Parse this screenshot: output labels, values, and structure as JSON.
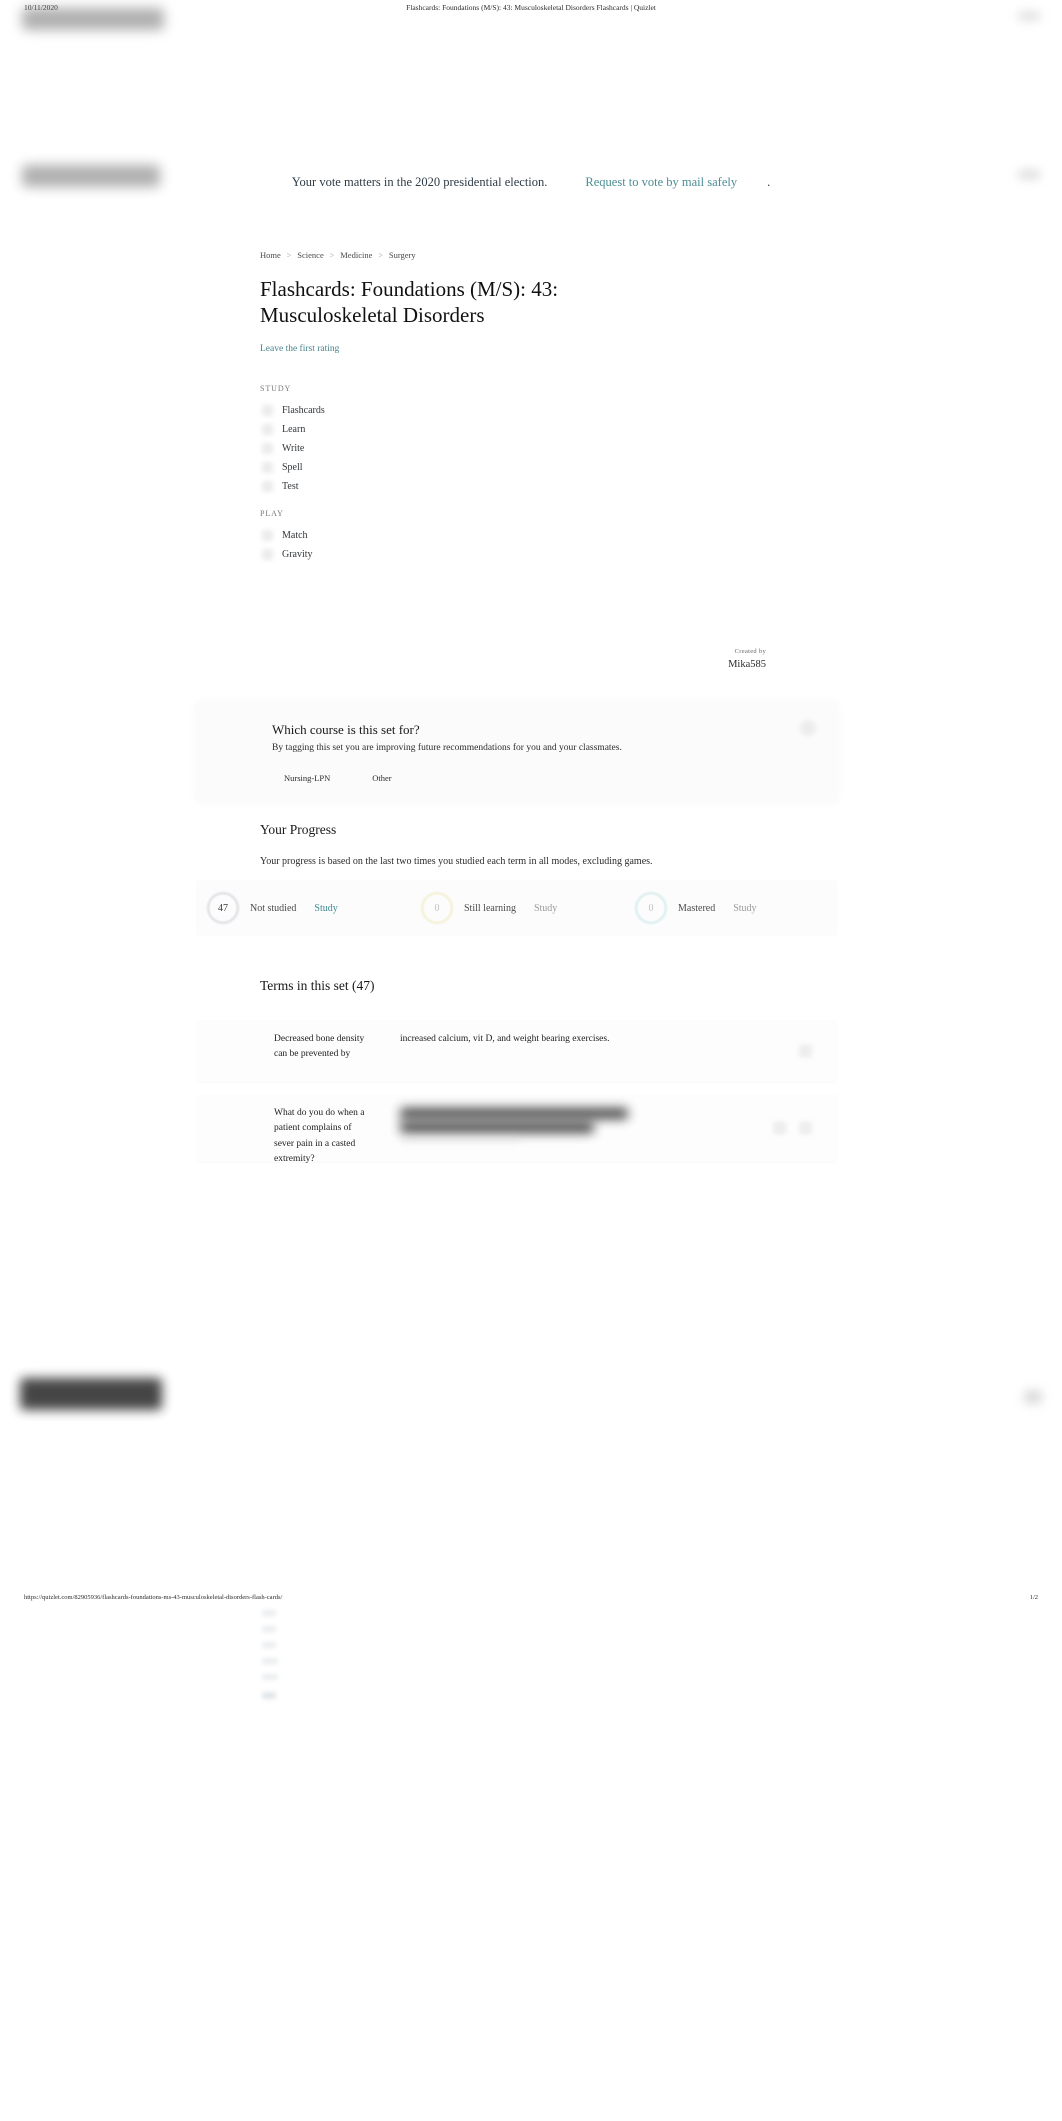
{
  "print_header": {
    "date": "10/11/2020",
    "document_title": "Flashcards: Foundations (M/S): 43: Musculoskeletal Disorders Flashcards | Quizlet"
  },
  "election_banner": {
    "message": "Your vote matters in the 2020 presidential election.",
    "link_label": "Request to vote by mail safely",
    "trailing": "."
  },
  "breadcrumb": {
    "items": [
      {
        "label": "Home"
      },
      {
        "label": "Science"
      },
      {
        "label": "Medicine"
      },
      {
        "label": "Surgery"
      }
    ],
    "separator": ">"
  },
  "set": {
    "title": "Flashcards: Foundations (M/S): 43: Musculoskeletal Disorders",
    "rating_link": "Leave the first rating",
    "created_by_label": "Created by",
    "creator": "Mika585"
  },
  "modes": {
    "study_group_label": "STUDY",
    "study_items": [
      {
        "label": "Flashcards",
        "icon": "flashcards-icon"
      },
      {
        "label": "Learn",
        "icon": "learn-icon"
      },
      {
        "label": "Write",
        "icon": "write-icon"
      },
      {
        "label": "Spell",
        "icon": "spell-icon"
      },
      {
        "label": "Test",
        "icon": "test-icon"
      }
    ],
    "play_group_label": "PLAY",
    "play_items": [
      {
        "label": "Match",
        "icon": "match-icon"
      },
      {
        "label": "Gravity",
        "icon": "gravity-icon"
      }
    ]
  },
  "course_card": {
    "title": "Which course is this set for?",
    "subtitle": "By tagging this set you are improving future recommendations for you and your classmates.",
    "chips": [
      {
        "label": "Nursing-LPN"
      },
      {
        "label": "Other"
      }
    ],
    "close_icon": "close-icon"
  },
  "progress": {
    "title": "Your Progress",
    "description": "Your progress is based on the last two times you studied each term in all modes, excluding games.",
    "cells": [
      {
        "count": "47",
        "label": "Not studied",
        "action": "Study",
        "accent": "#3d8b92"
      },
      {
        "count": "0",
        "label": "Still learning",
        "action": "Study",
        "accent": "#9a9a9a"
      },
      {
        "count": "0",
        "label": "Mastered",
        "action": "Study",
        "accent": "#9a9a9a"
      }
    ]
  },
  "terms": {
    "heading": "Terms in this set (47)",
    "count": 47,
    "rows": [
      {
        "term": "Decreased bone density can be prevented by",
        "definition": "increased calcium, vit D, and weight bearing exercises.",
        "redacted": false
      },
      {
        "term": "What do you do when a patient complains of sever pain in a casted extremity?",
        "definition": "",
        "redacted": true
      }
    ]
  },
  "print_footer": {
    "url": "https://quizlet.com/82905936/flashcards-foundations-ms-43-musculoskeletal-disorders-flash-cards/",
    "page": "1/2"
  },
  "colors": {
    "link": "#45838c",
    "teal_accent": "#3d8b92",
    "text": "#1a1a1a",
    "muted": "#9a9a9a"
  }
}
